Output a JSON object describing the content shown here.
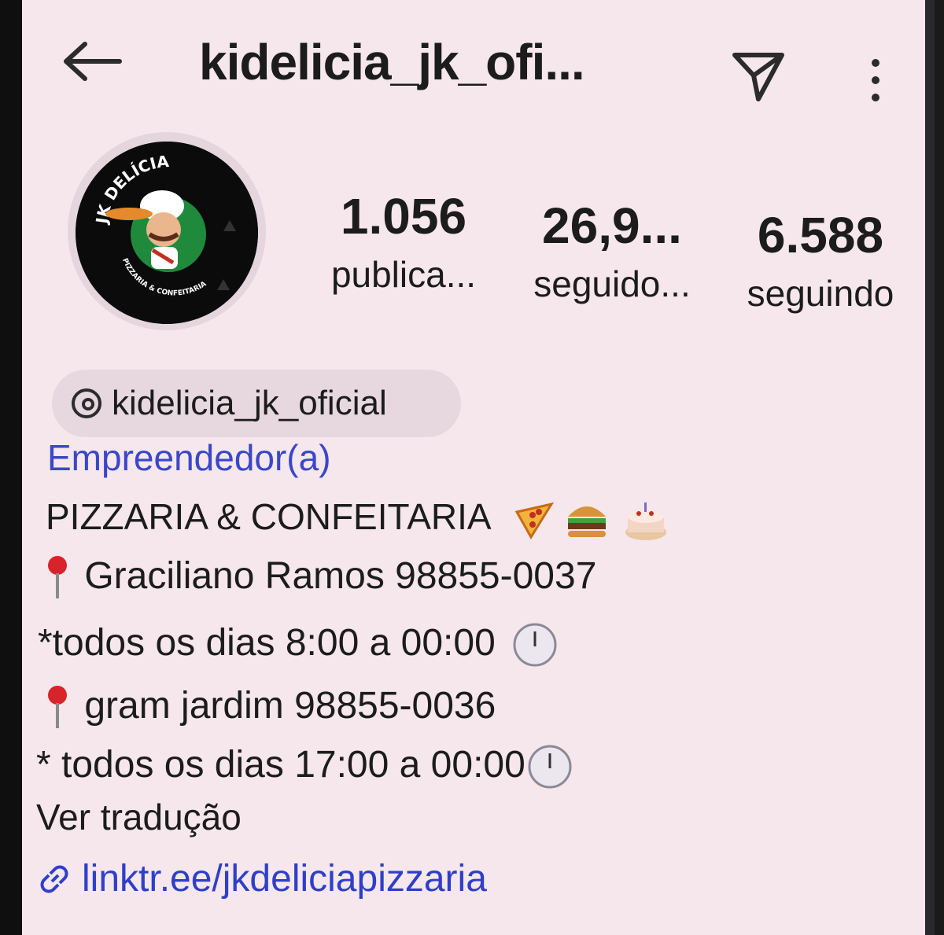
{
  "header": {
    "title": "kidelicia_jk_ofi...",
    "back_icon": "arrow-left-icon",
    "send_icon": "send-icon",
    "menu_icon": "more-vertical-icon"
  },
  "avatar": {
    "logo_text_top": "JK DELÍCIA",
    "logo_text_bottom": "PIZZARIA & CONFEITARIA"
  },
  "stats": [
    {
      "value": "1.056",
      "label": "publica..."
    },
    {
      "value": "26,9...",
      "label": "seguido..."
    },
    {
      "value": "6.588",
      "label": "seguindo"
    }
  ],
  "threads": {
    "handle": "kidelicia_jk_oficial",
    "icon": "threads-icon"
  },
  "bio": {
    "category": "Empreendedor(a)",
    "line1": "PIZZARIA & CONFEITARIA",
    "line2": "Graciliano Ramos 98855-0037",
    "line3": "*todos os dias 8:00 a 00:00",
    "line4": "gram jardim 98855-0036",
    "line5": "* todos os dias 17:00 a 00:00",
    "translate": "Ver tradução",
    "link": "linktr.ee/jkdeliciapizzaria"
  },
  "colors": {
    "background": "#f5e7ec",
    "accent_blue": "#3a47c8",
    "link_blue": "#2f3fc8",
    "text": "#1c1c1c"
  }
}
